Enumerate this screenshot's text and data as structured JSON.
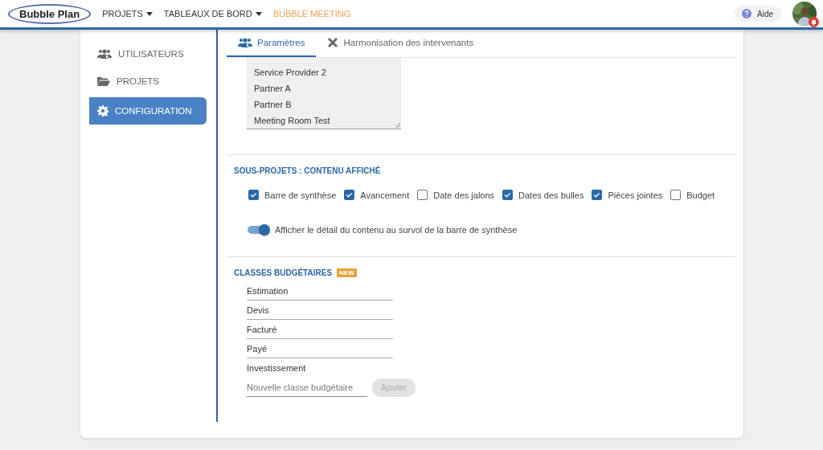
{
  "header": {
    "logo": "Bubble Plan",
    "nav": [
      {
        "label": "PROJETS",
        "dropdown": true,
        "highlight": false
      },
      {
        "label": "TABLEAUX DE BORD",
        "dropdown": true,
        "highlight": false
      },
      {
        "label": "BUBBLE MEETING",
        "dropdown": false,
        "highlight": true
      }
    ],
    "help": "Aide",
    "notifications": true
  },
  "sidebar": {
    "items": [
      {
        "label": "UTILISATEURS",
        "selected": false
      },
      {
        "label": "PROJETS",
        "selected": false
      },
      {
        "label": "CONFIGURATION",
        "selected": true
      }
    ]
  },
  "tabs": [
    {
      "label": "Paramètres",
      "selected": true
    },
    {
      "label": "Harmonisation des intervenants",
      "selected": false
    }
  ],
  "participants_list": [
    "Service Provider 2",
    "Partner A",
    "Partner B",
    "Meeting Room Test"
  ],
  "subprojects": {
    "title": "SOUS-PROJETS : CONTENU AFFICHÉ",
    "options": [
      {
        "label": "Barre de synthèse",
        "checked": true
      },
      {
        "label": "Avancement",
        "checked": true
      },
      {
        "label": "Date des jalons",
        "checked": false
      },
      {
        "label": "Dates des bulles",
        "checked": true
      },
      {
        "label": "Pièces jointes",
        "checked": true
      },
      {
        "label": "Budget",
        "checked": false
      }
    ],
    "toggle": {
      "label": "Afficher le détail du contenu au survol de la barre de synthèse",
      "on": true
    }
  },
  "budget": {
    "title": "CLASSES BUDGÉTAIRES",
    "badge": "NEW",
    "classes": [
      "Estimation",
      "Devis",
      "Facturé",
      "Payé",
      "Investissement"
    ],
    "new_placeholder": "Nouvelle classe budgétaire",
    "add_button": {
      "label": "Ajouter",
      "disabled": true
    }
  }
}
